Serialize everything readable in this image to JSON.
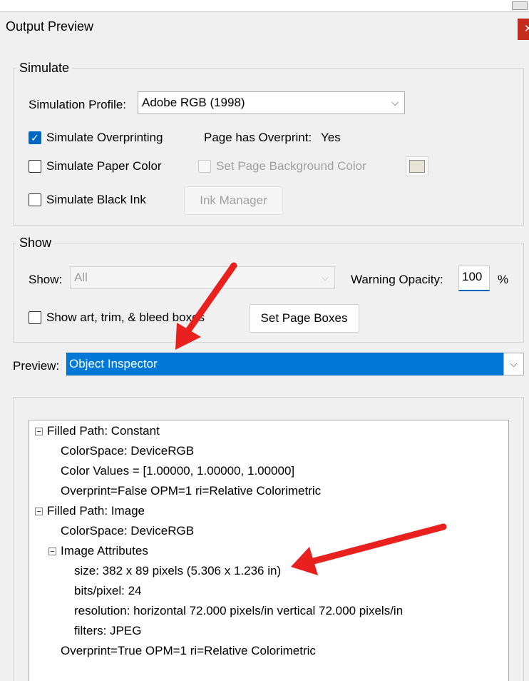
{
  "window": {
    "title": "Output Preview",
    "close_glyph": "✕"
  },
  "simulate": {
    "group_label": "Simulate",
    "profile_label": "Simulation Profile:",
    "profile_value": "Adobe RGB (1998)",
    "overprinting_label": "Simulate Overprinting",
    "overprinting_checked": true,
    "page_overprint_label": "Page has Overprint:",
    "page_overprint_value": "Yes",
    "paper_color_label": "Simulate Paper Color",
    "bg_color_label": "Set Page Background Color",
    "black_ink_label": "Simulate Black Ink",
    "ink_manager_label": "Ink Manager"
  },
  "show": {
    "group_label": "Show",
    "show_label": "Show:",
    "show_value": "All",
    "warning_opacity_label": "Warning Opacity:",
    "warning_opacity_value": "100",
    "percent_sign": "%",
    "boxes_label": "Show art, trim, & bleed boxes",
    "set_page_boxes_label": "Set Page Boxes"
  },
  "preview": {
    "label": "Preview:",
    "value": "Object Inspector"
  },
  "inspector": {
    "lines": [
      {
        "text": "Filled Path: Constant"
      },
      {
        "text": "ColorSpace: DeviceRGB"
      },
      {
        "text": "Color Values = [1.00000, 1.00000, 1.00000]"
      },
      {
        "text": "Overprint=False OPM=1 ri=Relative Colorimetric"
      },
      {
        "text": "Filled Path: Image"
      },
      {
        "text": "ColorSpace: DeviceRGB"
      },
      {
        "text": "Image Attributes"
      },
      {
        "text": "size: 382 x 89 pixels (5.306 x 1.236 in)"
      },
      {
        "text": "bits/pixel: 24"
      },
      {
        "text": "resolution: horizontal 72.000 pixels/in vertical 72.000 pixels/in"
      },
      {
        "text": "filters: JPEG"
      },
      {
        "text": "Overprint=True OPM=1 ri=Relative Colorimetric"
      }
    ]
  },
  "colors": {
    "accent": "#0078d7",
    "annotation_arrow": "#e8201e",
    "close": "#c42b1c"
  }
}
